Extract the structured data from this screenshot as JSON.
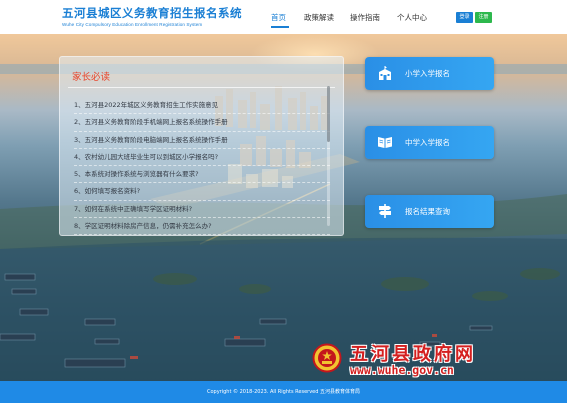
{
  "header": {
    "logo_cn": "五河县城区义务教育招生报名系统",
    "logo_en": "Wuhe City Compulsory Education Enrollment Registration System",
    "nav": [
      "首页",
      "政策解读",
      "操作指南",
      "个人中心"
    ],
    "login": "登录",
    "register": "注册",
    "accent": "#1a7fd4"
  },
  "notice": {
    "title": "家长必读",
    "items": [
      "1、五河县2022年城区义务教育招生工作实施意见",
      "2、五河县义务教育阶段手机端网上报名系统操作手册",
      "3、五河县义务教育阶段电脑端网上报名系统操作手册",
      "4、农村幼儿园大班毕业生可以到城区小学报名吗?",
      "5、本系统对操作系统与浏览器有什么要求?",
      "6、如何填写报名资料?",
      "7、如何在系统中正确填写学区证明材料?",
      "8、学区证明材料除房产信息，仍需补充怎么办?"
    ]
  },
  "actions": [
    {
      "label": "小学入学报名",
      "icon": "school-building-icon"
    },
    {
      "label": "中学入学报名",
      "icon": "open-book-icon"
    },
    {
      "label": "报名结果查询",
      "icon": "signpost-icon"
    }
  ],
  "watermark": {
    "title": "五河县政府网",
    "url": "www.wuhe.gov.cn",
    "color": "#d41f1f"
  },
  "footer": {
    "copyright": "Copyright © 2018-2023. All Rights Reserved 五河县教育体育局"
  }
}
